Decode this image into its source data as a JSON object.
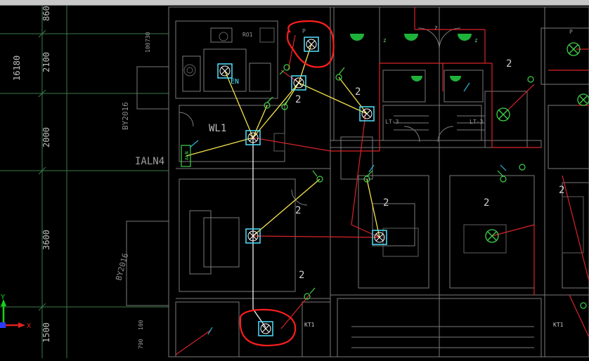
{
  "dimension_labels": [
    "16180",
    "2100",
    "2000",
    "3600",
    "1500"
  ],
  "top_dimension": "860",
  "left_dims": [
    "730",
    "100",
    "790",
    "100"
  ],
  "circuit": {
    "cable_label": "WL1",
    "panel_label": "IALN4",
    "panel_tag": "ALN",
    "en_label": "EN",
    "wall_tag": "BY2016",
    "wall_tag_upper": "BY2016"
  },
  "room_labels": [
    "2",
    "2",
    "2",
    "2",
    "2",
    "2",
    "2",
    "2"
  ],
  "room_tags": [
    "P",
    "P",
    "z",
    "z",
    "z",
    "KT1",
    "KT1",
    "LT-3",
    "LT-3",
    "RO1"
  ],
  "ucs": {
    "y_label": "Y",
    "x_label": "X"
  },
  "colors": {
    "background": "#000000",
    "wire_red": "#e0262a",
    "wire_yellow": "#f4e24c",
    "wire_white": "#f2f2f2",
    "fixture_cyan": "#4fe3ff",
    "switch_green": "#3fd04a",
    "highlight_red": "#ff1e1e",
    "wall_gray": "#7d7d7d",
    "dim_line": "#2f8f4f",
    "axis_green": "#17d11a",
    "axis_red": "#e02020",
    "axis_blue": "#2a3cff"
  }
}
